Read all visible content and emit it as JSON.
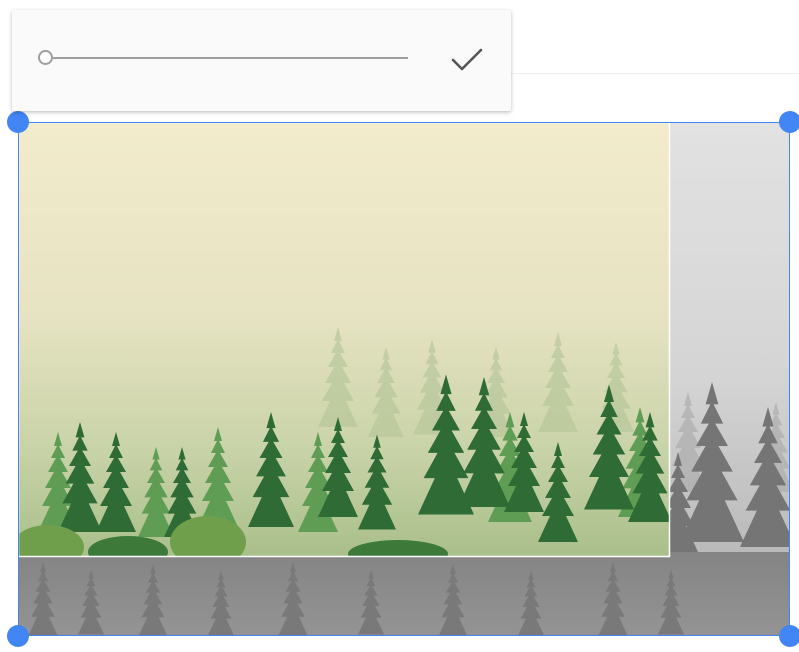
{
  "toolbar": {
    "slider": {
      "value": 0,
      "min": 0,
      "max": 100
    },
    "confirm_icon": "check-icon"
  },
  "image": {
    "subject": "foggy-pine-forest",
    "crop_handles": [
      "top-left",
      "top-right",
      "bottom-left",
      "bottom-right"
    ]
  },
  "colors": {
    "accent": "#4285f4",
    "slider": "#9e9e9e",
    "check": "#555555",
    "toolbar_bg": "#fafafa"
  }
}
